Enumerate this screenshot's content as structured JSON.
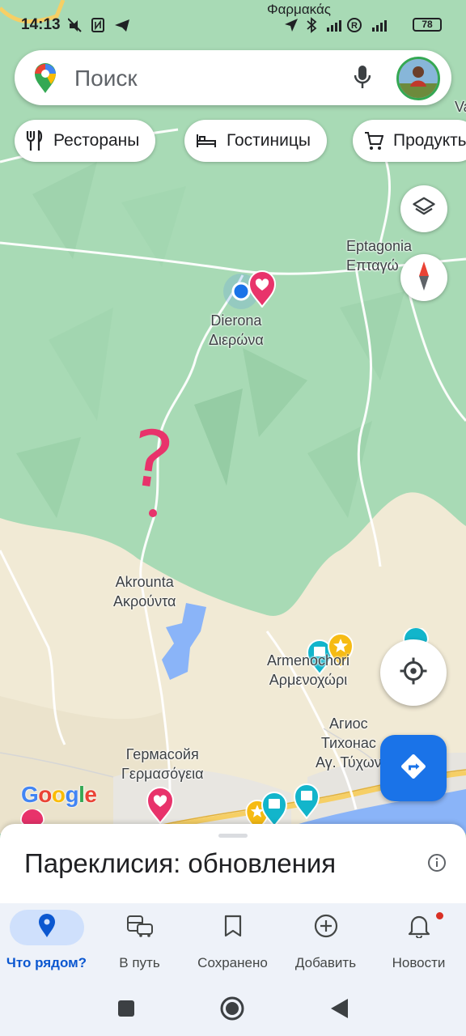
{
  "status_bar": {
    "time": "14:13",
    "top_place_label": "Φαρμακάς",
    "battery": "78"
  },
  "search": {
    "placeholder": "Поиск"
  },
  "chips": [
    {
      "label": "Рестораны",
      "icon": "restaurant-icon"
    },
    {
      "label": "Гостиницы",
      "icon": "hotel-icon"
    },
    {
      "label": "Продукты",
      "icon": "cart-icon"
    }
  ],
  "map": {
    "labels": {
      "eptagonia_latin": "Eptagonia",
      "eptagonia_greek": "Επταγώ",
      "dierona_latin": "Dierona",
      "dierona_greek": "Διερώνα",
      "akrounta_latin": "Akrounta",
      "akrounta_greek": "Ακρούντα",
      "armenochori_latin": "Armenochori",
      "armenochori_greek": "Αρμενοχώρι",
      "agios_line1": "Агиос",
      "agios_line2": "Тихонас",
      "agios_line3": "Αγ. Τύχων",
      "germasogeia_cyr": "Гермасойя",
      "germasogeia_greek": "Γερμασόγεια",
      "edge_right_va": "Va"
    },
    "annotation": "?",
    "google_logo": "Google"
  },
  "sheet": {
    "title": "Пареклисия: обновления"
  },
  "bottom_nav": [
    {
      "label": "Что рядом?",
      "icon": "location-pin-icon",
      "active": true
    },
    {
      "label": "В путь",
      "icon": "commute-icon",
      "active": false
    },
    {
      "label": "Сохранено",
      "icon": "bookmark-icon",
      "active": false
    },
    {
      "label": "Добавить",
      "icon": "add-circle-icon",
      "active": false
    },
    {
      "label": "Новости",
      "icon": "bell-icon",
      "active": false
    }
  ],
  "colors": {
    "forest": "#a8dab5",
    "land": "#f1ead5",
    "water": "#8ab4f8",
    "accent": "#1a73e8",
    "favorite_pin": "#e8336b"
  }
}
